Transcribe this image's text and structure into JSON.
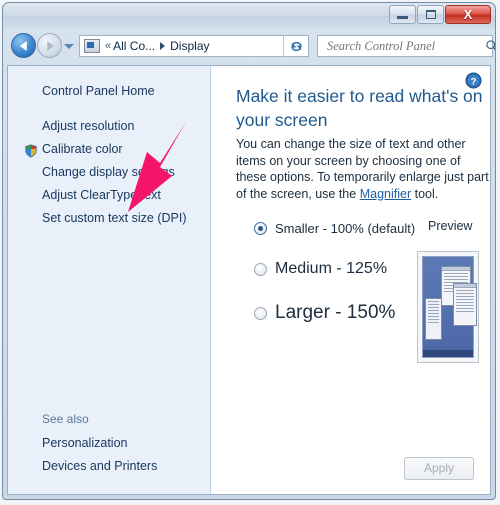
{
  "window": {
    "minimize_label": "Minimize",
    "maximize_label": "Maximize",
    "close_label": "X"
  },
  "nav": {
    "back_label": "Back",
    "forward_label": "Forward",
    "history_label": "Recent pages",
    "breadcrumb": {
      "overflow": "«",
      "root": "All Co...",
      "current": "Display"
    },
    "refresh_label": "Refresh"
  },
  "search": {
    "placeholder": "Search Control Panel",
    "value": ""
  },
  "sidebar": {
    "home_label": "Control Panel Home",
    "items": [
      {
        "label": "Adjust resolution",
        "shield": false
      },
      {
        "label": "Calibrate color",
        "shield": true
      },
      {
        "label": "Change display settings",
        "shield": false
      },
      {
        "label": "Adjust ClearType text",
        "shield": false
      },
      {
        "label": "Set custom text size (DPI)",
        "shield": false
      }
    ],
    "see_also_title": "See also",
    "see_also": [
      {
        "label": "Personalization"
      },
      {
        "label": "Devices and Printers"
      }
    ]
  },
  "main": {
    "help_label": "Help",
    "title": "Make it easier to read what's on your screen",
    "description_part1": "You can change the size of text and other items on your screen by choosing one of these options. To temporarily enlarge just part of the screen, use the ",
    "description_link": "Magnifier",
    "description_part2": " tool.",
    "options": [
      {
        "label": "Smaller - 100% (default)",
        "selected": true
      },
      {
        "label": "Medium - 125%",
        "selected": false
      },
      {
        "label": "Larger - 150%",
        "selected": false
      }
    ],
    "preview_label": "Preview",
    "apply_label": "Apply",
    "apply_disabled": true
  },
  "annotation": {
    "arrow_color": "#f4156a",
    "points_to": "Set custom text size (DPI)"
  }
}
